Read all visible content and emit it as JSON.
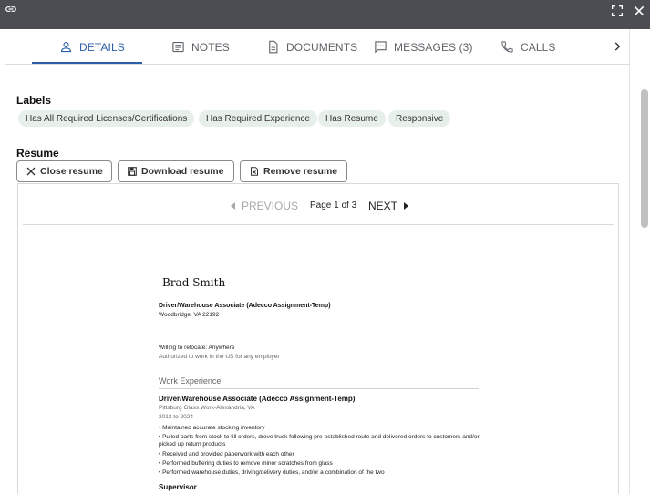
{
  "tabs": [
    {
      "label": "DETAILS",
      "icon": "person-icon"
    },
    {
      "label": "NOTES",
      "icon": "notes-icon"
    },
    {
      "label": "DOCUMENTS",
      "icon": "document-icon"
    },
    {
      "label": "MESSAGES (3)",
      "icon": "message-icon"
    },
    {
      "label": "CALLS",
      "icon": "phone-icon"
    }
  ],
  "labels": {
    "title": "Labels",
    "chips": [
      "Has All Required Licenses/Certifications",
      "Has Required Experience",
      "Has Resume",
      "Responsive"
    ]
  },
  "resume": {
    "title": "Resume",
    "buttons": {
      "close": "Close resume",
      "download": "Download resume",
      "remove": "Remove resume"
    },
    "pager": {
      "prev": "PREVIOUS",
      "info": "Page 1 of 3",
      "next": "NEXT"
    },
    "doc": {
      "name": "Brad Smith",
      "headline": "Driver/Warehouse Associate (Adecco Assignment-Temp)",
      "location": "Woodbridge, VA 22192",
      "relocate": "Willing to relocate: Anywhere",
      "authorized": "Authorized to work in the US for any employer",
      "work_experience": "Work Experience",
      "job": {
        "title": "Driver/Warehouse Associate (Adecco Assignment-Temp)",
        "company": "Pittsburg Glass Work-Alexandria, VA",
        "dates": "2013 to 2024",
        "bullets": [
          "• Maintained accurate stocking inventory",
          "• Pulled parts from stock to fill orders, drove truck following pre-established route and delivered orders to customers and/or picked up return products",
          "• Received and provided paperwork with each other",
          "• Performed buffering duties to remove minor scratches from glass",
          "• Performed warehouse duties, driving/delivery duties, and/or a combination of the two"
        ]
      },
      "next_job": "Supervisor"
    }
  },
  "colors": {
    "topbar": "#4b4d52",
    "accent": "#2c5fa8",
    "chip_bg": "#e6efe9"
  }
}
